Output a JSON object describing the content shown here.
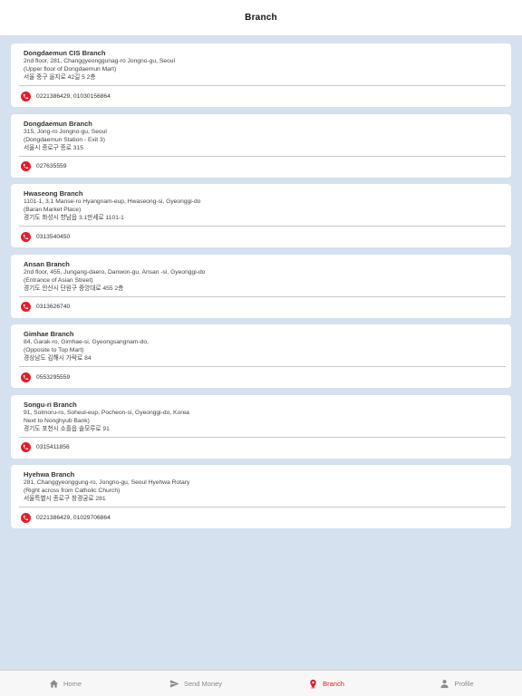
{
  "header": {
    "title": "Branch"
  },
  "branches": [
    {
      "name": "Dongdaemun CIS Branch",
      "address": [
        "2nd floor, 281, Changgyeonggunag-ro Jongno-gu, Seoul",
        "(Upper floor of Dongdaemun Mart)",
        "서울 중구 을지로 42길 5 2층"
      ],
      "phone": "0221386429, 01030156864"
    },
    {
      "name": "Dongdaemun Branch",
      "address": [
        "315, Jong-ro Jongno-gu, Seoul",
        "(Dongdaemun Station - Exit 3)",
        "서울시 종로구 종로 315"
      ],
      "phone": "027635559"
    },
    {
      "name": "Hwaseong Branch",
      "address": [
        "1101-1, 3.1 Manse-ro Hyangnam-eup, Hwaseong-si, Gyeonggi-do",
        "(Baran Market Place)",
        "경기도 화성시 향남읍 3.1만세로 1101-1"
      ],
      "phone": "0313540450"
    },
    {
      "name": "Ansan Branch",
      "address": [
        "2nd floor,  455,  Jungang-daero, Danwon-gu, Ansan -si, Gyeonggi-do",
        "(Entrance of Asian Street)",
        "경기도 안산시 단원구 중앙대로 455 2층"
      ],
      "phone": "0313626740"
    },
    {
      "name": "Gimhae Branch",
      "address": [
        "84, Garak-ro, Gimhae-si, Gyeongsangnam-do,",
        "(Opposite to Top Mart)",
        "경상남도 김해시 가락로 84"
      ],
      "phone": "0553295559"
    },
    {
      "name": "Songu-ri Branch",
      "address": [
        "91, Solmoru-ro, Soheul-eup, Pocheon-si, Gyeonggi-do,  Korea",
        "Next to Nonghyub Bank)",
        "경기도 포천시 소흘읍 솔모루로 91"
      ],
      "phone": "0315411856"
    },
    {
      "name": "Hyehwa Branch",
      "address": [
        "281, Changgyeonggung-ro, Jongno-gu, Seoul Hyehwa Rotary",
        "(Right across from Catholic Church)",
        "서울특별시 종로구 창경궁로 281"
      ],
      "phone": "0221386429, 01029706864"
    }
  ],
  "tabs": [
    {
      "id": "home",
      "label": "Home",
      "icon": "home-icon"
    },
    {
      "id": "send-money",
      "label": "Send Money",
      "icon": "send-icon"
    },
    {
      "id": "branch",
      "label": "Branch",
      "icon": "location-pin-icon",
      "active": true
    },
    {
      "id": "profile",
      "label": "Profile",
      "icon": "person-icon"
    }
  ],
  "colors": {
    "accent": "#e11d2a",
    "background": "#d5e1ee",
    "inactive": "#8a8a8a"
  }
}
